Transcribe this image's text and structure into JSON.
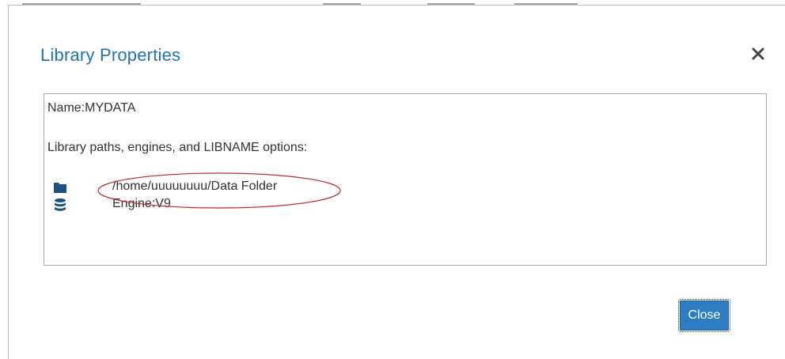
{
  "dialog": {
    "title": "Library Properties",
    "close_icon": "close-icon",
    "close_button_label": "Close"
  },
  "library": {
    "name_line": "Name:MYDATA",
    "paths_label": "Library paths, engines, and LIBNAME options:",
    "path": "/home/uuuuuuuu/Data Folder",
    "path_icon": "folder-icon",
    "engine": "Engine:V9",
    "engine_icon": "database-icon"
  },
  "colors": {
    "title": "#1f73b7",
    "icon": "#1e4f82",
    "button": "#2d7dc4",
    "annotation": "#c0282d",
    "text": "#333333"
  }
}
